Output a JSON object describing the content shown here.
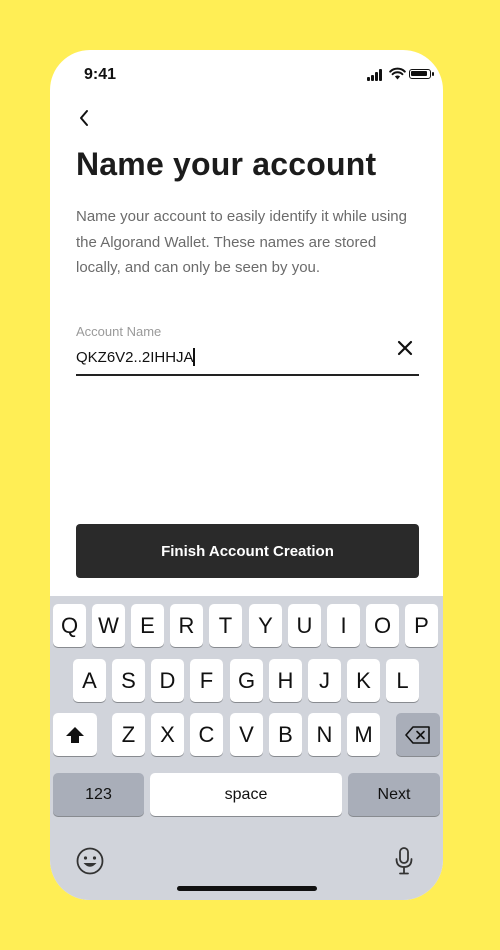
{
  "status_bar": {
    "time": "9:41"
  },
  "header": {
    "title": "Name your account"
  },
  "description": "Name your account to easily identify it while using the Algorand Wallet. These names are stored locally, and can only be seen by you.",
  "account_name_field": {
    "label": "Account Name",
    "value": "QKZ6V2..2IHHJA"
  },
  "actions": {
    "finish_label": "Finish Account Creation"
  },
  "colors": {
    "background": "#FFEE55",
    "button": "#2A2A2A",
    "keyboard": "#D1D4DB"
  },
  "keyboard": {
    "row1": [
      "Q",
      "W",
      "E",
      "R",
      "T",
      "Y",
      "U",
      "I",
      "O",
      "P"
    ],
    "row2": [
      "A",
      "S",
      "D",
      "F",
      "G",
      "H",
      "J",
      "K",
      "L"
    ],
    "row3": [
      "Z",
      "X",
      "C",
      "V",
      "B",
      "N",
      "M"
    ],
    "numbers_label": "123",
    "space_label": "space",
    "next_label": "Next",
    "icons": [
      "shift-icon",
      "backspace-icon",
      "emoji-icon",
      "microphone-icon"
    ]
  }
}
